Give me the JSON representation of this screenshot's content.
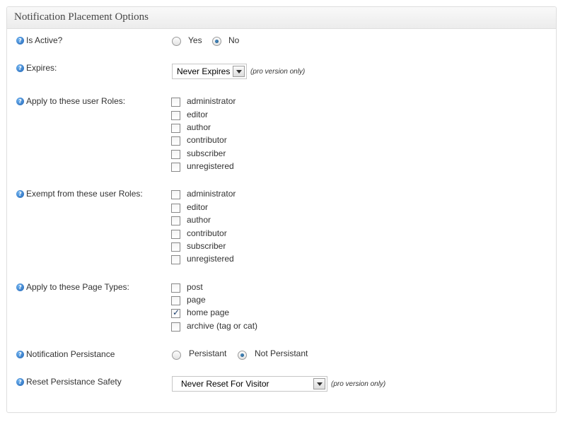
{
  "panel": {
    "title": "Notification Placement Options"
  },
  "is_active": {
    "label": "Is Active?",
    "options": [
      {
        "label": "Yes",
        "selected": false
      },
      {
        "label": "No",
        "selected": true
      }
    ]
  },
  "expires": {
    "label": "Expires:",
    "selected": "Never Expires",
    "note": "(pro version only)"
  },
  "apply_roles": {
    "label": "Apply to these user Roles:",
    "items": [
      {
        "label": "administrator",
        "checked": false
      },
      {
        "label": "editor",
        "checked": false
      },
      {
        "label": "author",
        "checked": false
      },
      {
        "label": "contributor",
        "checked": false
      },
      {
        "label": "subscriber",
        "checked": false
      },
      {
        "label": "unregistered",
        "checked": false
      }
    ]
  },
  "exempt_roles": {
    "label": "Exempt from these user Roles:",
    "items": [
      {
        "label": "administrator",
        "checked": false
      },
      {
        "label": "editor",
        "checked": false
      },
      {
        "label": "author",
        "checked": false
      },
      {
        "label": "contributor",
        "checked": false
      },
      {
        "label": "subscriber",
        "checked": false
      },
      {
        "label": "unregistered",
        "checked": false
      }
    ]
  },
  "page_types": {
    "label": "Apply to these Page Types:",
    "items": [
      {
        "label": "post",
        "checked": false
      },
      {
        "label": "page",
        "checked": false
      },
      {
        "label": "home page",
        "checked": true
      },
      {
        "label": "archive (tag or cat)",
        "checked": false
      }
    ]
  },
  "persistance": {
    "label": "Notification Persistance",
    "options": [
      {
        "label": "Persistant",
        "selected": false
      },
      {
        "label": "Not Persistant",
        "selected": true
      }
    ]
  },
  "reset_safety": {
    "label": "Reset Persistance Safety",
    "selected": "Never Reset For Visitor",
    "note": "(pro version only)"
  },
  "icons": {
    "help": "help-icon"
  },
  "colors": {
    "help_icon": "#1f63b5",
    "panel_border": "#dfdfdf",
    "header_bg": "#ececec"
  }
}
